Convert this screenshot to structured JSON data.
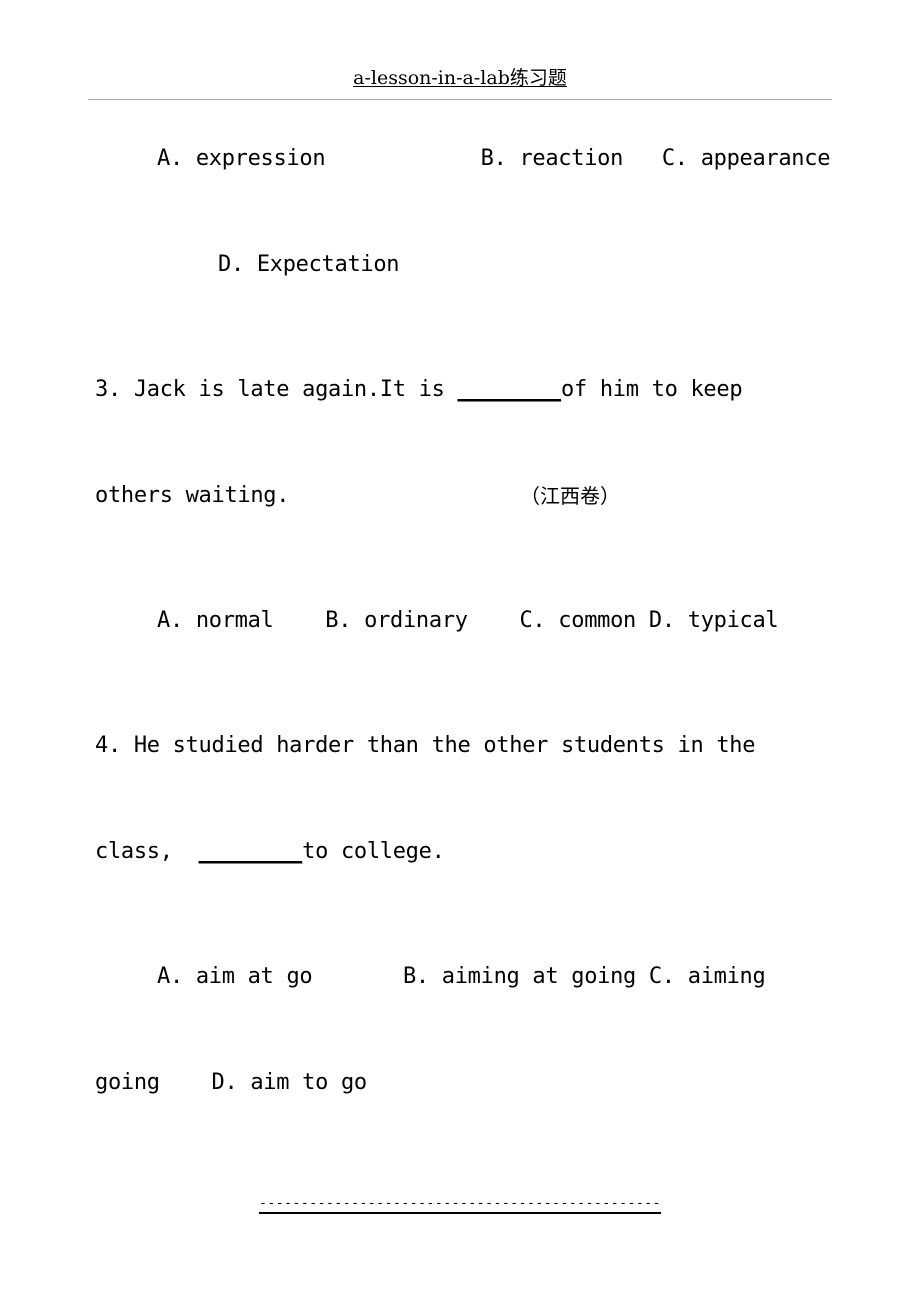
{
  "document": {
    "header": {
      "title": "a-lesson-in-a-lab练习题"
    },
    "footer": {
      "separator": "------------------------------------------------"
    },
    "lines": [
      {
        "id": "q2-options-abc",
        "kind": "options",
        "text": "A. expression            B. reaction   C. appearance"
      },
      {
        "id": "q2-option-d",
        "kind": "option-d",
        "text": "D. Expectation"
      },
      {
        "id": "q3-stem-line1-pre",
        "kind": "question",
        "text": "3. Jack is late again.It is "
      },
      {
        "id": "q3-stem-line1-blank",
        "kind": "blank",
        "text": "________"
      },
      {
        "id": "q3-stem-line1-post",
        "kind": "question",
        "text": "of him to keep"
      },
      {
        "id": "q3-stem-line2",
        "kind": "question",
        "text": "others waiting."
      },
      {
        "id": "q3-source",
        "kind": "source",
        "text": "（江西卷）"
      },
      {
        "id": "q3-options",
        "kind": "options",
        "text": "A. normal    B. ordinary    C. common D. typical"
      },
      {
        "id": "q4-stem-line1",
        "kind": "question",
        "text": "4. He studied harder than the other students in the"
      },
      {
        "id": "q4-stem-line2-pre",
        "kind": "question",
        "text": "class,  "
      },
      {
        "id": "q4-stem-line2-blank",
        "kind": "blank",
        "text": "________"
      },
      {
        "id": "q4-stem-line2-post",
        "kind": "question",
        "text": "to college."
      },
      {
        "id": "q4-options-line1",
        "kind": "options",
        "text": "A. aim at go       B. aiming at going C. aiming"
      },
      {
        "id": "q4-options-line2",
        "kind": "question",
        "text": "going    D. aim to go"
      }
    ],
    "questions": [
      {
        "number": "2",
        "options": [
          {
            "label": "A.",
            "text": "expression"
          },
          {
            "label": "B.",
            "text": "reaction"
          },
          {
            "label": "C.",
            "text": "appearance"
          },
          {
            "label": "D.",
            "text": "Expectation"
          }
        ]
      },
      {
        "number": "3",
        "stem": "3. Jack is late again.It is ________of him to keep others waiting.",
        "source": "（江西卷）",
        "options": [
          {
            "label": "A.",
            "text": "normal"
          },
          {
            "label": "B.",
            "text": "ordinary"
          },
          {
            "label": "C.",
            "text": "common"
          },
          {
            "label": "D.",
            "text": "typical"
          }
        ]
      },
      {
        "number": "4",
        "stem": "4. He studied harder than the other students in the class,  ________to college.",
        "options": [
          {
            "label": "A.",
            "text": "aim at go"
          },
          {
            "label": "B.",
            "text": "aiming at going"
          },
          {
            "label": "C.",
            "text": "aiming going"
          },
          {
            "label": "D.",
            "text": "aim to go"
          }
        ]
      }
    ]
  }
}
